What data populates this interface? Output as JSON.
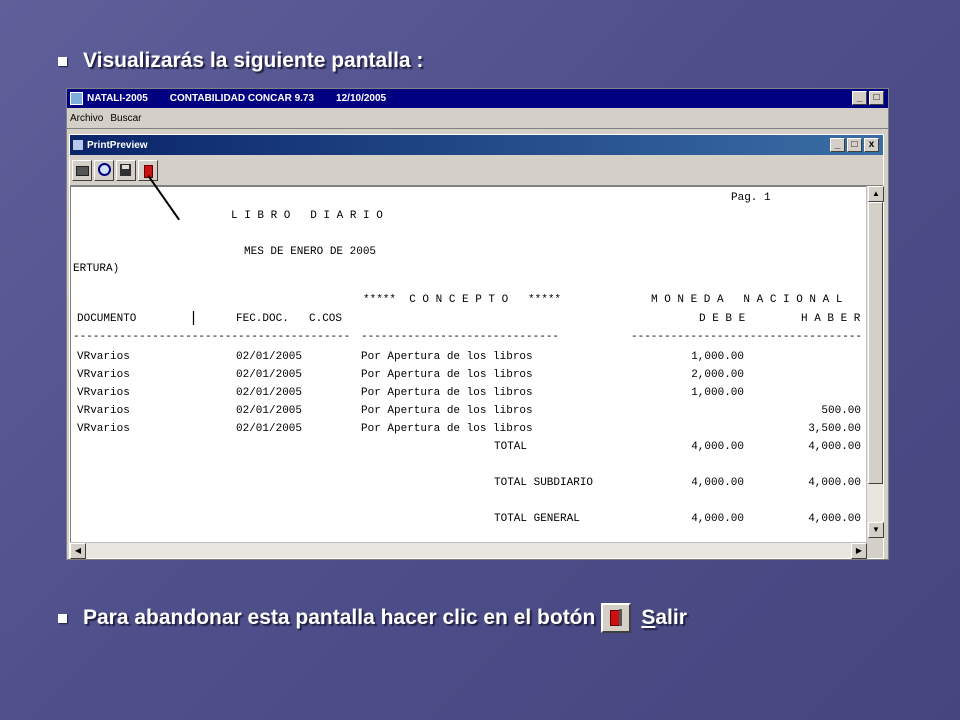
{
  "slide": {
    "line1": "Visualizarás la siguiente pantalla :",
    "line2_prefix": "Para abandonar esta pantalla hacer clic en el botón",
    "line2_salir_S": "S",
    "line2_salir_rest": "alir"
  },
  "app": {
    "title_parts": [
      "NATALI-2005",
      "CONTABILIDAD CONCAR 9.73",
      "12/10/2005"
    ],
    "menu": [
      "Archivo",
      "Buscar"
    ],
    "window_buttons": [
      "_",
      "□"
    ]
  },
  "print_preview": {
    "title": "PrintPreview",
    "window_buttons": [
      "_",
      "□",
      "x"
    ],
    "toolbar_icons": [
      "printer-icon",
      "zoom-icon",
      "save-icon",
      "exit-icon"
    ]
  },
  "report": {
    "page": "Pag. 1",
    "title": "L I B R O   D I A R I O",
    "period": "MES DE ENERO DE 2005",
    "subtitle": "ERTURA)",
    "concepto_header": "*****  C O N C E P T O   *****",
    "moneda_header": "M O N E D A   N A C I O N A L",
    "col_documento": "DOCUMENTO",
    "col_separator": "|",
    "col_fecdoc": "FEC.DOC.",
    "col_ccos": "C.COS",
    "col_debe": "D E B E",
    "col_haber": "H A B E R",
    "dash1": "------------------------------------------",
    "dash2": "------------------------------",
    "dash3": "-----------------------------------",
    "rows": [
      {
        "doc": "VRvarios",
        "fecha": "02/01/2005",
        "concepto": "Por Apertura de los libros",
        "debe": "1,000.00",
        "haber": ""
      },
      {
        "doc": "VRvarios",
        "fecha": "02/01/2005",
        "concepto": "Por Apertura de los libros",
        "debe": "2,000.00",
        "haber": ""
      },
      {
        "doc": "VRvarios",
        "fecha": "02/01/2005",
        "concepto": "Por Apertura de los libros",
        "debe": "1,000.00",
        "haber": ""
      },
      {
        "doc": "VRvarios",
        "fecha": "02/01/2005",
        "concepto": "Por Apertura de los libros",
        "debe": "",
        "haber": "500.00"
      },
      {
        "doc": "VRvarios",
        "fecha": "02/01/2005",
        "concepto": "Por Apertura de los libros",
        "debe": "",
        "haber": "3,500.00"
      }
    ],
    "totals": [
      {
        "label": "TOTAL",
        "debe": "4,000.00",
        "haber": "4,000.00"
      },
      {
        "label": "TOTAL SUBDIARIO",
        "debe": "4,000.00",
        "haber": "4,000.00"
      },
      {
        "label": "TOTAL GENERAL",
        "debe": "4,000.00",
        "haber": "4,000.00"
      }
    ]
  }
}
